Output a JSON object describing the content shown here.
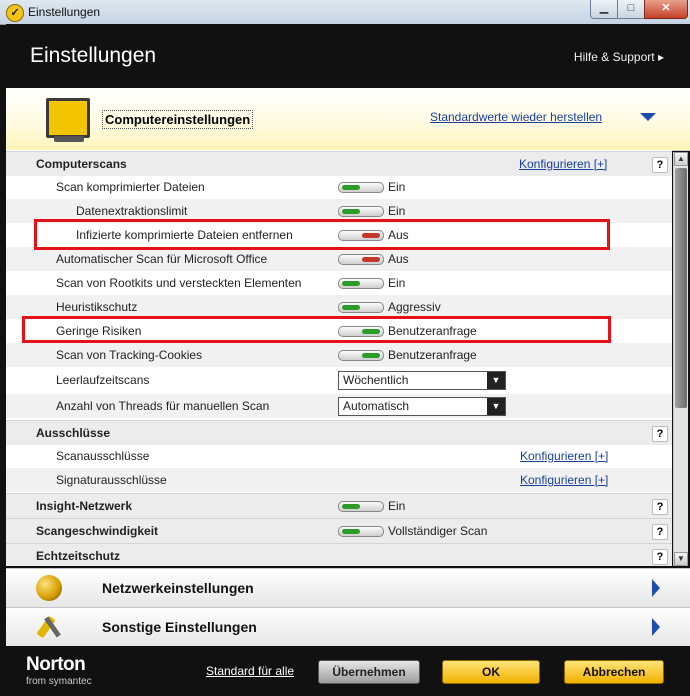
{
  "window": {
    "title": "Einstellungen",
    "controls": {
      "minimize": "▁",
      "maximize": "□",
      "close": "✕"
    }
  },
  "header": {
    "title": "Einstellungen",
    "help": "Hilfe & Support"
  },
  "computer_section": {
    "title": "Computereinstellungen",
    "restore_link": "Standardwerte wieder herstellen"
  },
  "sections": {
    "computerscans": {
      "title": "Computerscans",
      "configure": "Konfigurieren [+]",
      "help": "?"
    },
    "ausschluesse": {
      "title": "Ausschlüsse",
      "help": "?"
    },
    "insight": {
      "title": "Insight-Netzwerk",
      "value": "Ein",
      "help": "?"
    },
    "scangeschwindigkeit": {
      "title": "Scangeschwindigkeit",
      "value": "Vollständiger Scan",
      "help": "?"
    },
    "echtzeitschutz": {
      "title": "Echtzeitschutz",
      "help": "?"
    }
  },
  "scan_rows": [
    {
      "label": "Scan komprimierter Dateien",
      "value": "Ein",
      "state": "on"
    },
    {
      "label": "Datenextraktionslimit",
      "value": "Ein",
      "state": "on"
    },
    {
      "label": "Infizierte komprimierte Dateien entfernen",
      "value": "Aus",
      "state": "off"
    },
    {
      "label": "Automatischer Scan für Microsoft Office",
      "value": "Aus",
      "state": "off"
    },
    {
      "label": "Scan von Rootkits und versteckten Elementen",
      "value": "Ein",
      "state": "on"
    },
    {
      "label": "Heuristikschutz",
      "value": "Aggressiv",
      "state": "on"
    },
    {
      "label": "Geringe Risiken",
      "value": "Benutzeranfrage",
      "state": "right"
    },
    {
      "label": "Scan von Tracking-Cookies",
      "value": "Benutzeranfrage",
      "state": "right"
    }
  ],
  "dropdown_rows": [
    {
      "label": "Leerlaufzeitscans",
      "value": "Wöchentlich"
    },
    {
      "label": "Anzahl von Threads für manuellen Scan",
      "value": "Automatisch"
    }
  ],
  "exclusion_rows": [
    {
      "label": "Scanausschlüsse",
      "configure": "Konfigurieren [+]"
    },
    {
      "label": "Signaturausschlüsse",
      "configure": "Konfigurieren [+]"
    }
  ],
  "categories": [
    {
      "title": "Netzwerkeinstellungen"
    },
    {
      "title": "Sonstige Einstellungen"
    }
  ],
  "footer": {
    "brand": "Norton",
    "brand_sub": "from symantec",
    "standard_link": "Standard für alle",
    "apply": "Übernehmen",
    "ok": "OK",
    "cancel": "Abbrechen"
  },
  "scroll": {
    "up": "▲",
    "down": "▼"
  },
  "colors": {
    "highlight": "#e3111a",
    "toggle_on": "#2c9b2c",
    "toggle_off": "#c0392b",
    "link": "#1a3f9c",
    "accent_yellow": "#f2b200"
  }
}
